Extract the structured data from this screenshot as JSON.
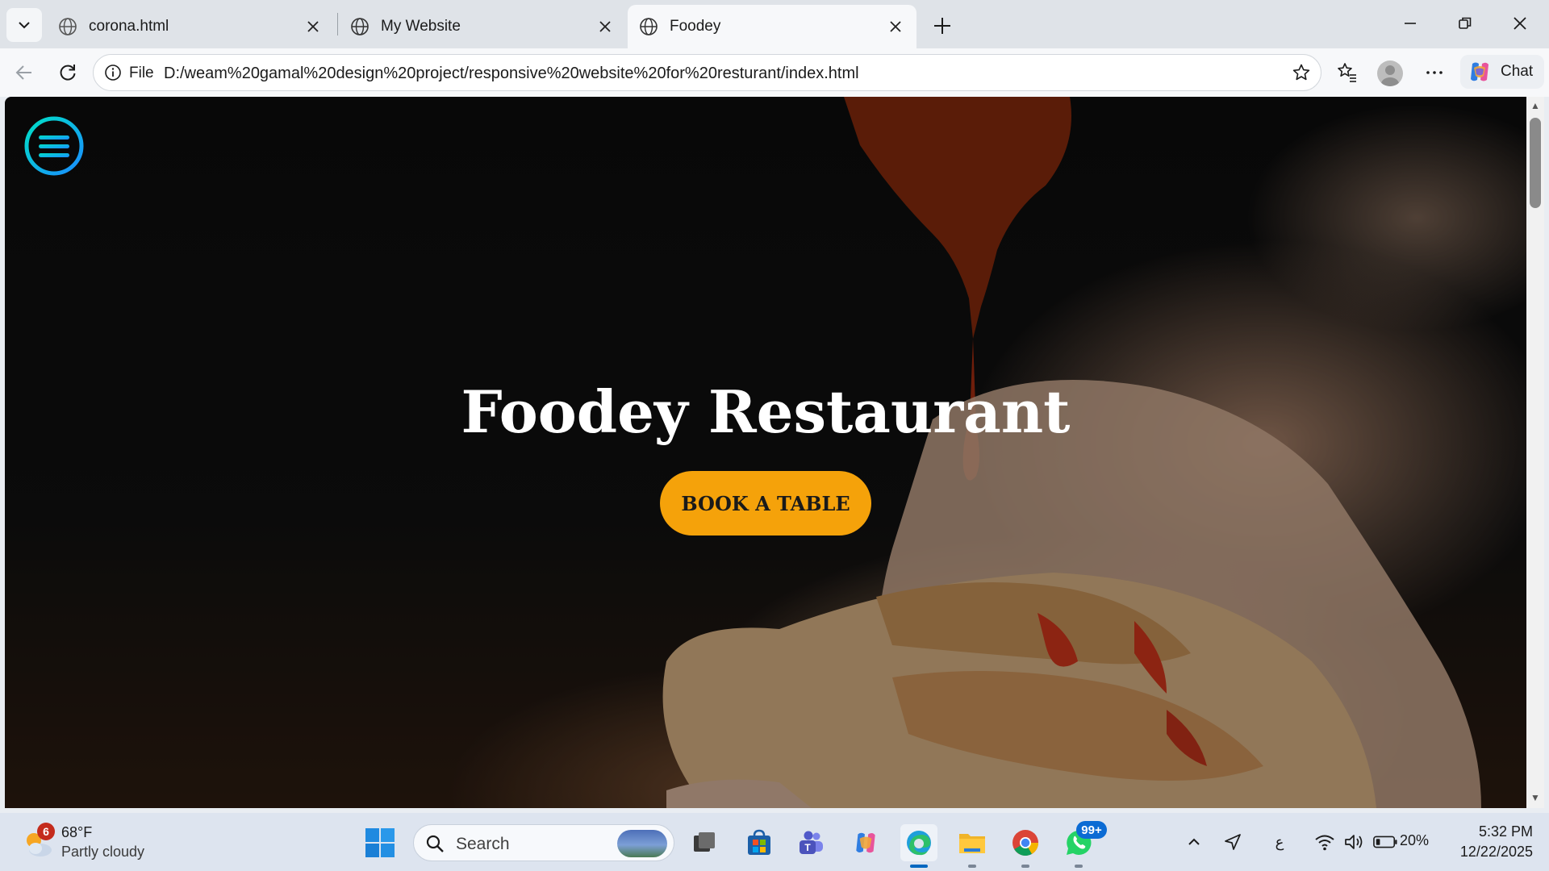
{
  "browser": {
    "tabs": [
      {
        "title": "corona.html",
        "active": false
      },
      {
        "title": "My Website",
        "active": false
      },
      {
        "title": "Foodey",
        "active": true
      }
    ],
    "address": {
      "scheme_label": "File",
      "url": "D:/weam%20gamal%20design%20project/responsive%20website%20for%20resturant/index.html"
    },
    "chat_label": "Chat"
  },
  "page": {
    "hero_title": "Foodey Restaurant",
    "cta_label": "BOOK A TABLE",
    "colors": {
      "accent": "#f5a20a",
      "menu_ring": "#00c2d6",
      "menu_ring_secondary": "#1aa8ff"
    }
  },
  "taskbar": {
    "weather": {
      "alerts": "6",
      "temp": "68°F",
      "condition": "Partly cloudy"
    },
    "search_placeholder": "Search",
    "whatsapp_badge": "99+",
    "tray": {
      "lang": "ع",
      "battery": "20%"
    },
    "clock": {
      "time": "5:32 PM",
      "date": "12/22/2025"
    }
  }
}
